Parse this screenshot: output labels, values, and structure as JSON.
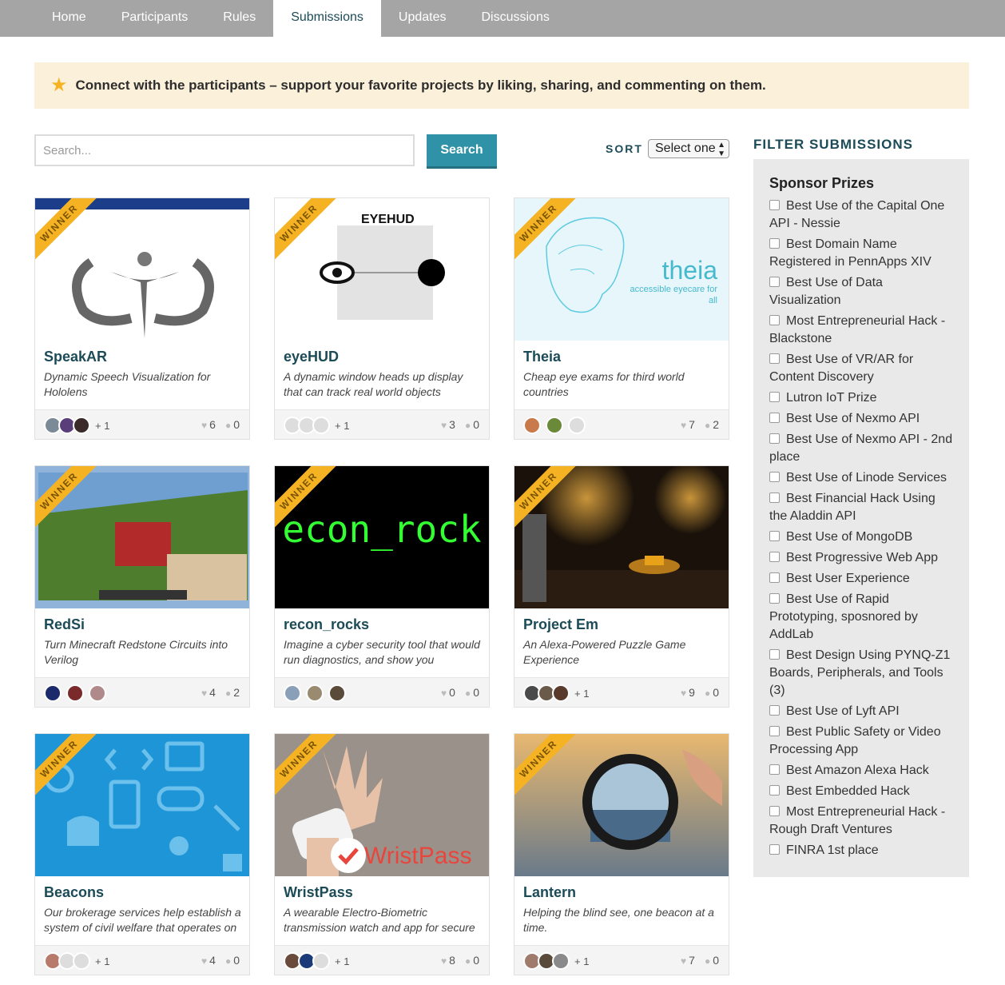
{
  "nav": {
    "tabs": [
      {
        "label": "Home"
      },
      {
        "label": "Participants"
      },
      {
        "label": "Rules"
      },
      {
        "label": "Submissions"
      },
      {
        "label": "Updates"
      },
      {
        "label": "Discussions"
      }
    ],
    "active_tab": "Submissions"
  },
  "banner": {
    "message": "Connect with the participants – support your favorite projects by liking, sharing, and commenting on them."
  },
  "search": {
    "placeholder": "Search...",
    "button_label": "Search"
  },
  "sort": {
    "label": "SORT",
    "selected": "Select one"
  },
  "ribbon_label": "WINNER",
  "submissions": [
    {
      "title": "SpeakAR",
      "description": "Dynamic Speech Visualization for Hololens",
      "extra_members": "+ 1",
      "likes": "6",
      "comments": "0"
    },
    {
      "title": "eyeHUD",
      "description": "A dynamic window heads up display that can track real world objects",
      "extra_members": "+ 1",
      "likes": "3",
      "comments": "0"
    },
    {
      "title": "Theia",
      "description": "Cheap eye exams for third world countries",
      "extra_members": "",
      "likes": "7",
      "comments": "2"
    },
    {
      "title": "RedSi",
      "description": "Turn Minecraft Redstone Circuits into Verilog",
      "extra_members": "",
      "likes": "4",
      "comments": "2"
    },
    {
      "title": "recon_rocks",
      "description": "Imagine a cyber security tool that would run diagnostics, and show you",
      "extra_members": "",
      "likes": "0",
      "comments": "0"
    },
    {
      "title": "Project Em",
      "description": "An Alexa-Powered Puzzle Game Experience",
      "extra_members": "+ 1",
      "likes": "9",
      "comments": "0"
    },
    {
      "title": "Beacons",
      "description": "Our brokerage services help establish a system of civil welfare that operates on",
      "extra_members": "+ 1",
      "likes": "4",
      "comments": "0"
    },
    {
      "title": "WristPass",
      "description": "A wearable Electro-Biometric transmission watch and app for secure",
      "extra_members": "+ 1",
      "likes": "8",
      "comments": "0"
    },
    {
      "title": "Lantern",
      "description": "Helping the blind see, one beacon at a time.",
      "extra_members": "+ 1",
      "likes": "7",
      "comments": "0"
    }
  ],
  "thumb_text": {
    "eyehud_logo": "EYEHUD",
    "theia_logo": "theia",
    "theia_tagline": "accessible eyecare for all",
    "recon_text": "econ_rock",
    "wristpass_text": "WristPass"
  },
  "sidebar": {
    "title": "FILTER SUBMISSIONS",
    "section": "Sponsor Prizes",
    "prizes": [
      "Best Use of the Capital One API - Nessie",
      "Best Domain Name Registered in PennApps XIV",
      "Best Use of Data Visualization",
      "Most Entrepreneurial Hack - Blackstone",
      "Best Use of VR/AR for Content Discovery",
      "Lutron IoT Prize",
      "Best Use of Nexmo API",
      "Best Use of Nexmo API - 2nd place",
      "Best Use of Linode Services",
      "Best Financial Hack Using the Aladdin API",
      "Best Use of MongoDB",
      "Best Progressive Web App",
      "Best User Experience",
      "Best Use of Rapid Prototyping, sposnored by AddLab",
      "Best Design Using PYNQ-Z1 Boards, Peripherals, and Tools (3)",
      "Best Use of Lyft API",
      "Best Public Safety or Video Processing App",
      "Best Amazon Alexa Hack",
      "Best Embedded Hack",
      "Most Entrepreneurial Hack - Rough Draft Ventures",
      "FINRA 1st place"
    ]
  },
  "colors": {
    "nav_bg": "#a5a5a5",
    "accent": "#2f92a6",
    "title_color": "#1c4b58",
    "ribbon": "#f5b324",
    "banner_bg": "#fbf0d9"
  }
}
